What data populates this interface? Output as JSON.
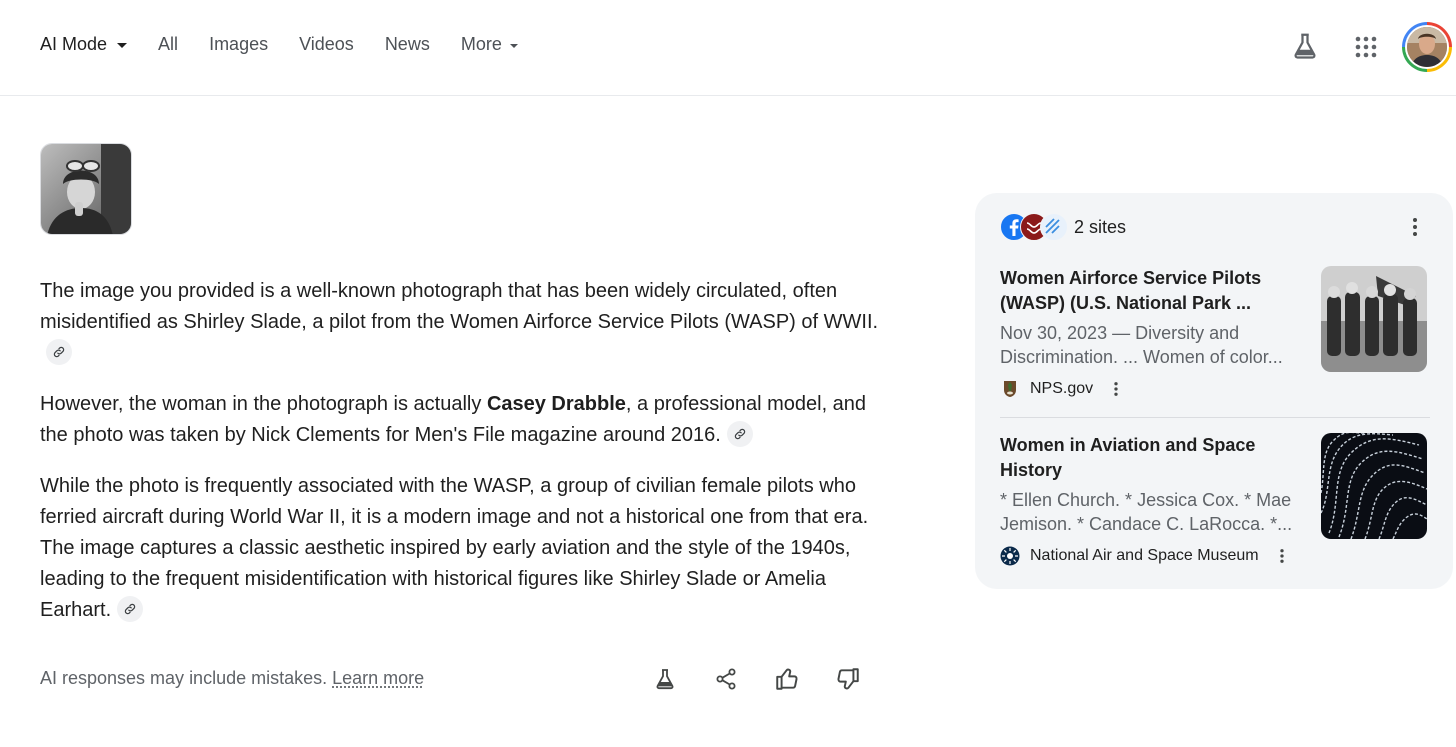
{
  "nav": {
    "tabs": [
      {
        "label": "AI Mode"
      },
      {
        "label": "All"
      },
      {
        "label": "Images"
      },
      {
        "label": "Videos"
      },
      {
        "label": "News"
      },
      {
        "label": "More"
      }
    ],
    "icons": [
      "labs-flask-icon",
      "apps-grid-icon",
      "account-avatar"
    ]
  },
  "answer": {
    "p1": "The image you provided is a well-known photograph that has been widely circulated, often misidentified as Shirley Slade, a pilot from the Women Airforce Service Pilots (WASP) of WWII.",
    "p2_before": "However, the woman in the photograph is actually ",
    "p2_bold": "Casey Drabble",
    "p2_after": ", a professional model, and the photo was taken by Nick Clements for Men's File magazine around 2016.",
    "p3": "While the photo is frequently associated with the WASP, a group of civilian female pilots who ferried aircraft during World War II, it is a modern image and not a historical one from that era. The image captures a classic aesthetic inspired by early aviation and the style of the 1940s, leading to the frequent misidentification with historical figures like Shirley Slade or Amelia Earhart."
  },
  "footer": {
    "disclaimer": "AI responses may include mistakes.",
    "learn_more": "Learn more"
  },
  "panel": {
    "sites_count": "2 sites",
    "sources": [
      {
        "title": "Women Airforce Service Pilots (WASP) (U.S. National Park ...",
        "snippet": "Nov 30, 2023 — Diversity and Discrimination. ... Women of color...",
        "site": "NPS.gov"
      },
      {
        "title": "Women in Aviation and Space History",
        "snippet": "* Ellen Church. * Jessica Cox. * Mae Jemison. * Candace C. LaRocca. *...",
        "site": "National Air and Space Museum"
      }
    ]
  },
  "colors": {
    "text": "#1f1f1f",
    "muted": "#5f6368",
    "panel_bg": "#f3f5f7",
    "divider": "#e8eaed"
  }
}
